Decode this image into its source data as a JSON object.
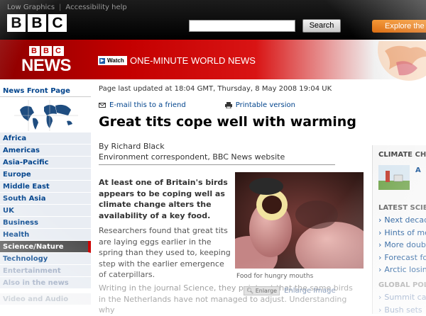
{
  "top_links": {
    "low_graphics": "Low Graphics",
    "separator": "|",
    "accessibility": "Accessibility help"
  },
  "bbc_letters": [
    "B",
    "B",
    "C"
  ],
  "search": {
    "placeholder": "",
    "button": "Search"
  },
  "explore_label": "Explore the",
  "banner": {
    "bbc": [
      "B",
      "B",
      "C"
    ],
    "news": "NEWS",
    "watch": "Watch",
    "one_minute": "ONE-MINUTE WORLD NEWS"
  },
  "nav": {
    "front_page": "News Front Page",
    "items": [
      "Africa",
      "Americas",
      "Asia-Pacific",
      "Europe",
      "Middle East",
      "South Asia",
      "UK",
      "Business",
      "Health"
    ],
    "active": "Science/Nature",
    "after": [
      "Technology",
      "Entertainment",
      "Also in the news"
    ],
    "faded": [
      "Video and Audio"
    ]
  },
  "article": {
    "updated": "Page last updated at 18:04 GMT, Thursday, 8 May 2008 19:04 UK",
    "email": "E-mail this to a friend",
    "printable": "Printable version",
    "headline": "Great tits cope well with warming",
    "author": "By Richard Black",
    "role": "Environment correspondent, BBC News website",
    "lead": "At least one of Britain's birds appears to be coping well as climate change alters the availability of a key food.",
    "body1": "Researchers found that great tits are laying eggs earlier in the spring than they used to, keeping step with the earlier emergence of caterpillars.",
    "body2": "Writing in the journal Science, they point out that the same birds in the Netherlands have not managed to adjust. Understanding why",
    "caption": "Food for hungry mouths",
    "enlarge_btn": "Enlarge",
    "enlarge_link": "Enlarge Image"
  },
  "sidebar": {
    "climate_heading": "CLIMATE CH",
    "climate_link": "A",
    "latest_heading": "LATEST SCIE",
    "latest_items": [
      "Next decad",
      "Hints of me",
      "More doubt",
      "Forecast fo",
      "Arctic losin"
    ],
    "global_heading": "GLOBAL POLI",
    "global_items": [
      "Summit call",
      "Bush sets"
    ]
  },
  "colors": {
    "accent_red": "#c40000",
    "link_blue": "#00438c",
    "nav_active": "#4d4d4d"
  }
}
